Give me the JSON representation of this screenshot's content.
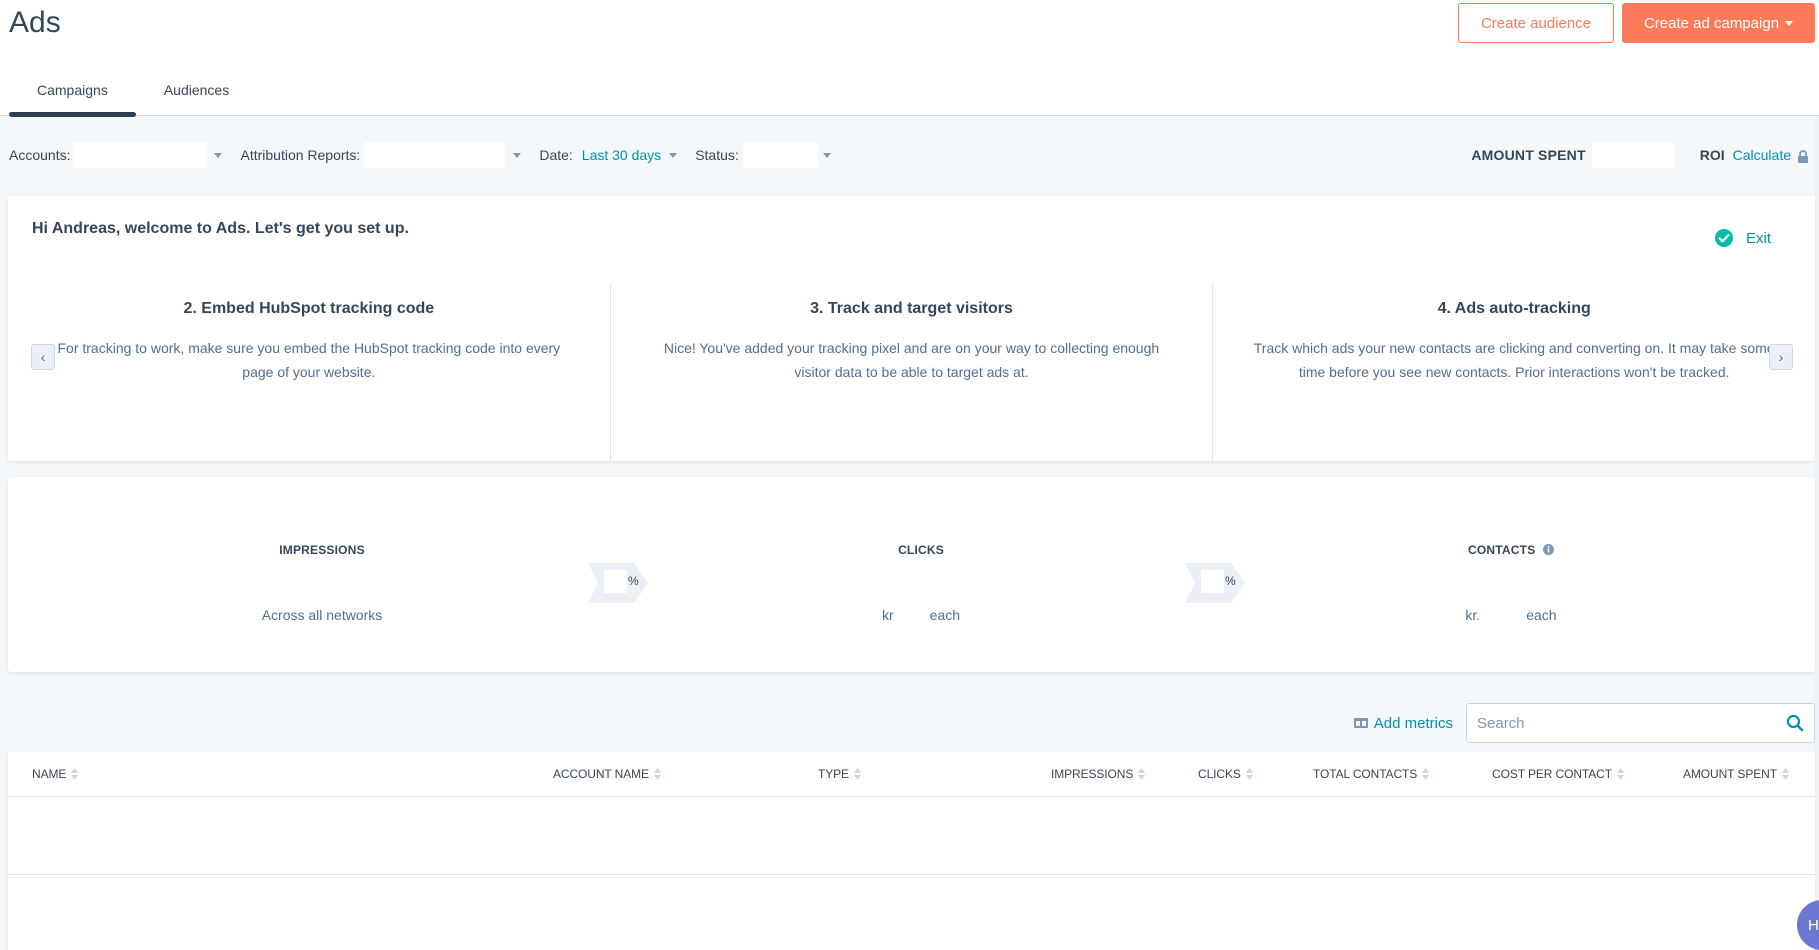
{
  "header": {
    "title": "Ads",
    "create_audience_label": "Create audience",
    "create_campaign_label": "Create ad campaign"
  },
  "tabs": [
    {
      "label": "Campaigns",
      "active": true
    },
    {
      "label": "Audiences",
      "active": false
    }
  ],
  "filters": {
    "accounts_label": "Accounts:",
    "accounts_value": "",
    "attribution_label": "Attribution Reports:",
    "attribution_value": "",
    "date_label": "Date:",
    "date_value": "Last 30 days",
    "status_label": "Status:",
    "status_value": "",
    "amount_spent_label": "AMOUNT SPENT",
    "amount_spent_value": "",
    "roi_label": "ROI",
    "roi_link": "Calculate"
  },
  "onboarding": {
    "welcome": "Hi Andreas, welcome to Ads. Let's get you set up.",
    "exit_label": "Exit",
    "steps": [
      {
        "title": "2. Embed HubSpot tracking code",
        "description": "For tracking to work, make sure you embed the HubSpot tracking code into every page of your website."
      },
      {
        "title": "3. Track and target visitors",
        "description": "Nice! You've added your tracking pixel and are on your way to collecting enough visitor data to be able to target ads at."
      },
      {
        "title": "4. Ads auto-tracking",
        "description": "Track which ads your new contacts are clicking and converting on. It may take some time before you see new contacts. Prior interactions won't be tracked."
      }
    ],
    "prev_label": "‹",
    "next_label": "›"
  },
  "metrics": {
    "impressions": {
      "title": "IMPRESSIONS",
      "subtitle": "Across all networks"
    },
    "clicks": {
      "title": "CLICKS",
      "currency": "kr",
      "per": "each"
    },
    "contacts": {
      "title": "CONTACTS",
      "currency": "kr.",
      "per": "each"
    },
    "rate_suffix": "%"
  },
  "table": {
    "add_metrics_label": "Add metrics",
    "search_placeholder": "Search",
    "columns": [
      "NAME",
      "ACCOUNT NAME",
      "TYPE",
      "IMPRESSIONS",
      "CLICKS",
      "TOTAL CONTACTS",
      "COST PER CONTACT",
      "AMOUNT SPENT"
    ],
    "rows": []
  },
  "help": {
    "label": "H"
  },
  "colors": {
    "accent": "#ff7a59",
    "link": "#0091ae",
    "text": "#33475b",
    "success": "#00bda5",
    "help": "#6a78d1"
  }
}
